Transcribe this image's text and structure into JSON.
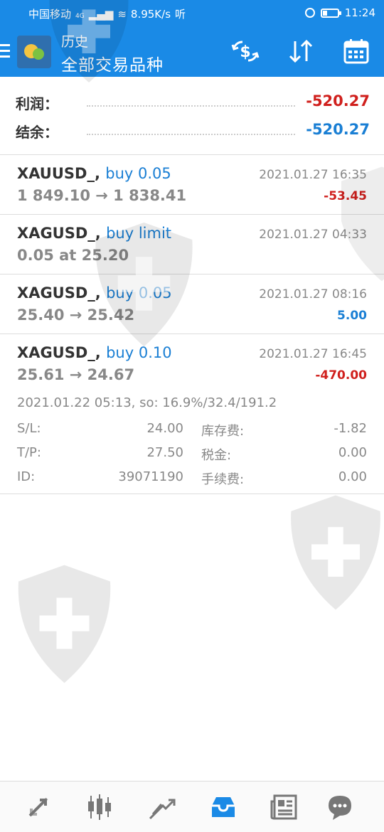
{
  "status_bar": {
    "carrier": "中国移动",
    "network": "4G",
    "speed": "8.95K/s",
    "extra": "听",
    "time": "11:24"
  },
  "header": {
    "title": "历史",
    "subtitle": "全部交易品种",
    "icons": [
      "menu-icon",
      "currency-exchange-icon",
      "sort-icon",
      "calendar-icon"
    ]
  },
  "summary": {
    "profit_label": "利润：",
    "profit_value": "-520.27",
    "balance_label": "结余：",
    "balance_value": "-520.27"
  },
  "deals": [
    {
      "symbol": "XAUUSD_,",
      "type": "buy 0.05",
      "time": "2021.01.27 16:35",
      "prices": "1 849.10 → 1 838.41",
      "profit": "-53.45"
    },
    {
      "symbol": "XAGUSD_,",
      "type": "buy limit",
      "time": "2021.01.27 04:33",
      "prices": "0.05 at 25.20",
      "profit": ""
    },
    {
      "symbol": "XAGUSD_,",
      "type": "buy 0.05",
      "time": "2021.01.27 08:16",
      "prices": "25.40 → 25.42",
      "profit": "5.00"
    },
    {
      "symbol": "XAGUSD_,",
      "type": "buy 0.10",
      "time": "2021.01.27 16:45",
      "prices": "25.61 → 24.67",
      "profit": "-470.00"
    }
  ],
  "expanded": {
    "open_info": "2021.01.22 05:13, so: 16.9%/32.4/191.2",
    "sl_label": "S/L:",
    "sl_value": "24.00",
    "tp_label": "T/P:",
    "tp_value": "27.50",
    "id_label": "ID:",
    "id_value": "39071190",
    "swap_label": "库存费:",
    "swap_value": "-1.82",
    "tax_label": "税金:",
    "tax_value": "0.00",
    "commission_label": "手续费:",
    "commission_value": "0.00"
  },
  "bottom_nav": {
    "items": [
      "quotes-icon",
      "chart-icon",
      "trade-icon",
      "history-icon",
      "news-icon",
      "messages-icon"
    ],
    "active": "history-icon",
    "accent": "#1a8ae6"
  },
  "colors": {
    "header_bg": "#1a8ae6",
    "negative": "#d0201d",
    "positive": "#1a7fd4"
  }
}
